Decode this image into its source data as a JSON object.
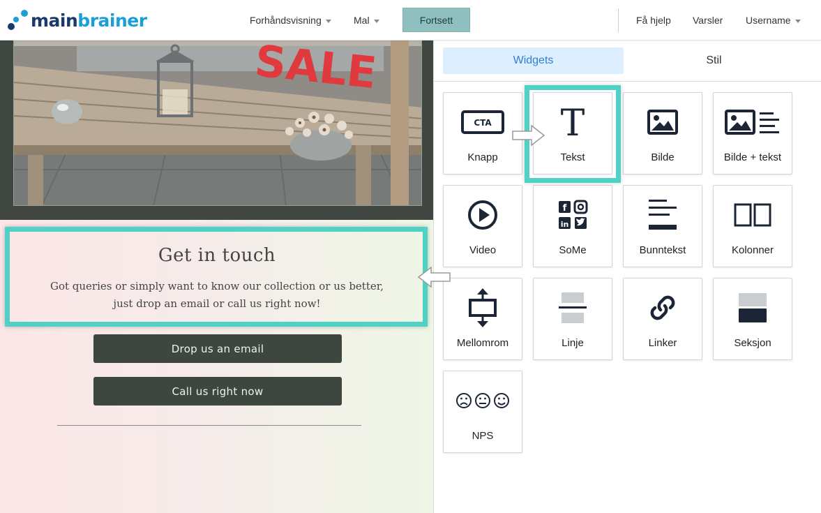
{
  "header": {
    "logo_part1": "main",
    "logo_part2": "brainer",
    "nav": {
      "preview_label": "Forhåndsvisning",
      "template_label": "Mal",
      "continue_label": "Fortsett",
      "help_label": "Få hjelp",
      "notifications_label": "Varsler",
      "user_label": "Username"
    }
  },
  "preview": {
    "photo_sign_text": "SALE",
    "heading": "Get in touch",
    "body_line1": "Got queries or simply want to know our collection or us better,",
    "body_line2": "just drop an email or call us right now!",
    "email_button_label": "Drop us an email",
    "call_button_label": "Call us right now"
  },
  "panel": {
    "tabs": [
      {
        "label": "Widgets",
        "active": true
      },
      {
        "label": "Stil",
        "active": false
      }
    ],
    "widgets": [
      {
        "label": "Knapp",
        "icon": "cta-button-icon",
        "icon_text": "CTA"
      },
      {
        "label": "Tekst",
        "icon": "text-icon",
        "icon_text": "T"
      },
      {
        "label": "Bilde",
        "icon": "image-icon"
      },
      {
        "label": "Bilde + tekst",
        "icon": "image-text-icon"
      },
      {
        "label": "Video",
        "icon": "video-play-icon"
      },
      {
        "label": "SoMe",
        "icon": "social-media-icon"
      },
      {
        "label": "Bunntekst",
        "icon": "footer-icon"
      },
      {
        "label": "Kolonner",
        "icon": "columns-icon"
      },
      {
        "label": "Mellomrom",
        "icon": "spacer-icon"
      },
      {
        "label": "Linje",
        "icon": "line-icon"
      },
      {
        "label": "Linker",
        "icon": "link-icon"
      },
      {
        "label": "Seksjon",
        "icon": "section-icon"
      },
      {
        "label": "NPS",
        "icon": "nps-faces-icon"
      }
    ]
  },
  "colors": {
    "highlight": "#4fd1c5",
    "continue_button": "#8fbfbf",
    "active_tab_bg": "#ddeefe",
    "active_tab_text": "#2f7fd1",
    "icon_dark": "#1c2536",
    "preview_button": "#3e4640"
  }
}
